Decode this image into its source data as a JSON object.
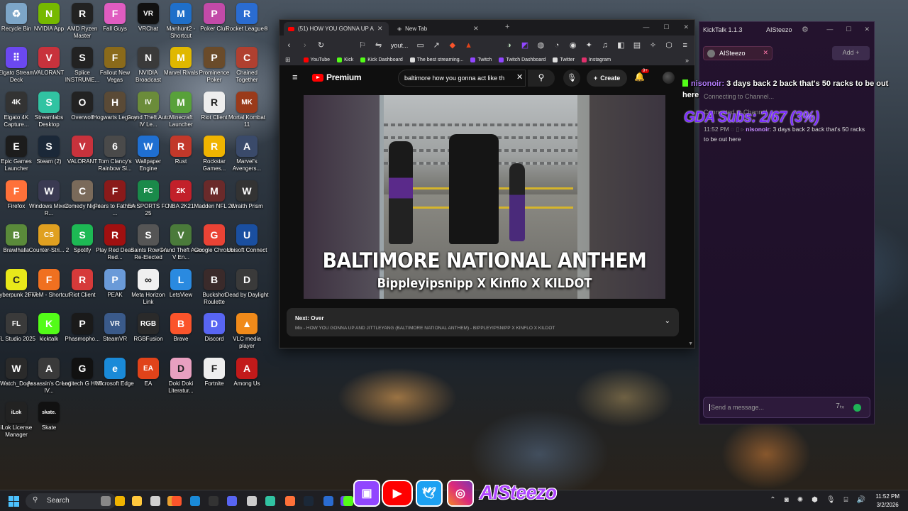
{
  "desktop": {
    "icons": [
      {
        "label": "Recycle Bin",
        "color": "#7da6c8",
        "glyph": "♻"
      },
      {
        "label": "NVIDIA App",
        "color": "#76b900",
        "glyph": "N"
      },
      {
        "label": "AMD Ryzen Master",
        "color": "#222222",
        "glyph": "R"
      },
      {
        "label": "Fall Guys",
        "color": "#e05cc0",
        "glyph": "F"
      },
      {
        "label": "VRChat",
        "color": "#111111",
        "glyph": "VR"
      },
      {
        "label": "Manhunt2 - Shortcut",
        "color": "#1f6fc9",
        "glyph": "M"
      },
      {
        "label": "Poker Club",
        "color": "#c24aa8",
        "glyph": "P"
      },
      {
        "label": "Rocket League®",
        "color": "#2a6cd1",
        "glyph": "R"
      },
      {
        "label": "Elgato Stream Deck",
        "color": "#6b48f0",
        "glyph": "⠿"
      },
      {
        "label": "VALORANT",
        "color": "#c8323c",
        "glyph": "V"
      },
      {
        "label": "Splice INSTRUME...",
        "color": "#222222",
        "glyph": "S"
      },
      {
        "label": "Fallout New Vegas",
        "color": "#8a6a1a",
        "glyph": "F"
      },
      {
        "label": "NVIDIA Broadcast",
        "color": "#3a3a3a",
        "glyph": "N"
      },
      {
        "label": "Marvel Rivals",
        "color": "#e0b800",
        "glyph": "M"
      },
      {
        "label": "Prominence Poker",
        "color": "#6a4b2a",
        "glyph": "P"
      },
      {
        "label": "Chained Together",
        "color": "#b04030",
        "glyph": "C"
      },
      {
        "label": "Elgato 4K Capture...",
        "color": "#333333",
        "glyph": "4K"
      },
      {
        "label": "Streamlabs Desktop",
        "color": "#31c3a2",
        "glyph": "S"
      },
      {
        "label": "Overwolf",
        "color": "#222222",
        "glyph": "O"
      },
      {
        "label": "Hogwarts Legacy",
        "color": "#5a4a36",
        "glyph": "H"
      },
      {
        "label": "Grand Theft Auto IV Le...",
        "color": "#6b8c3a",
        "glyph": "IV"
      },
      {
        "label": "Minecraft Launcher",
        "color": "#58a13a",
        "glyph": "M"
      },
      {
        "label": "Riot Client",
        "color": "#eeeeee",
        "glyph": "R"
      },
      {
        "label": "Mortal Kombat 11",
        "color": "#9a3a1a",
        "glyph": "MK"
      },
      {
        "label": "Epic Games Launcher",
        "color": "#1c1c1c",
        "glyph": "E"
      },
      {
        "label": "Steam (2)",
        "color": "#1b2838",
        "glyph": "S"
      },
      {
        "label": "VALORANT",
        "color": "#c8323c",
        "glyph": "V"
      },
      {
        "label": "Tom Clancy's Rainbow Si...",
        "color": "#4a4a4a",
        "glyph": "6"
      },
      {
        "label": "Wallpaper Engine",
        "color": "#1f6fd1",
        "glyph": "W"
      },
      {
        "label": "Rust",
        "color": "#c2382a",
        "glyph": "R"
      },
      {
        "label": "Rockstar Games...",
        "color": "#f0b400",
        "glyph": "R"
      },
      {
        "label": "Marvel's Avengers...",
        "color": "#3a4a6a",
        "glyph": "A"
      },
      {
        "label": "Firefox",
        "color": "#ff7139",
        "glyph": "F"
      },
      {
        "label": "Windows Mixed R...",
        "color": "#3a3a52",
        "glyph": "W"
      },
      {
        "label": "Comedy Night",
        "color": "#7a6a5a",
        "glyph": "C"
      },
      {
        "label": "Fears to Fathom ...",
        "color": "#8a1a1a",
        "glyph": "F"
      },
      {
        "label": "EA SPORTS FC 25",
        "color": "#1a8a4a",
        "glyph": "FC"
      },
      {
        "label": "NBA 2K21",
        "color": "#c2202a",
        "glyph": "2K"
      },
      {
        "label": "Madden NFL 25",
        "color": "#6a2a2a",
        "glyph": "M"
      },
      {
        "label": "Wraith Prism",
        "color": "#333333",
        "glyph": "W"
      },
      {
        "label": "Brawlhalla",
        "color": "#5a8a3a",
        "glyph": "B"
      },
      {
        "label": "Counter-Stri... 2",
        "color": "#e0a020",
        "glyph": "CS"
      },
      {
        "label": "Spotify",
        "color": "#1db954",
        "glyph": "S"
      },
      {
        "label": "Play Red Dead Red...",
        "color": "#a01010",
        "glyph": "R"
      },
      {
        "label": "Saints Row IV Re-Elected",
        "color": "#555555",
        "glyph": "S"
      },
      {
        "label": "Grand Theft Auto V En...",
        "color": "#4a7a3a",
        "glyph": "V"
      },
      {
        "label": "Google Chrome",
        "color": "#ea4335",
        "glyph": "G"
      },
      {
        "label": "Ubisoft Connect",
        "color": "#1a4fa0",
        "glyph": "U"
      },
      {
        "label": "Cyberpunk 2077",
        "color": "#e8e81a",
        "glyph": "C"
      },
      {
        "label": "FiveM - Shortcut",
        "color": "#f07020",
        "glyph": "F"
      },
      {
        "label": "Riot Client",
        "color": "#d63a3a",
        "glyph": "R"
      },
      {
        "label": "PEAK",
        "color": "#6a9ad8",
        "glyph": "P"
      },
      {
        "label": "Meta Horizon Link",
        "color": "#f0f0f0",
        "glyph": "∞"
      },
      {
        "label": "LetsView",
        "color": "#2a8ae0",
        "glyph": "L"
      },
      {
        "label": "Buckshot Roulette",
        "color": "#3a2a2a",
        "glyph": "B"
      },
      {
        "label": "Dead by Daylight",
        "color": "#3a3a3a",
        "glyph": "D"
      },
      {
        "label": "FL Studio 2025",
        "color": "#3a3a3a",
        "glyph": "FL"
      },
      {
        "label": "kicktalk",
        "color": "#53fc18",
        "glyph": "K"
      },
      {
        "label": "Phasmopho...",
        "color": "#1a1a1a",
        "glyph": "P"
      },
      {
        "label": "SteamVR",
        "color": "#3a5a8a",
        "glyph": "VR"
      },
      {
        "label": "RGBFusion",
        "color": "#2a2a2a",
        "glyph": "RGB"
      },
      {
        "label": "Brave",
        "color": "#fb542b",
        "glyph": "B"
      },
      {
        "label": "Discord",
        "color": "#5865f2",
        "glyph": "D"
      },
      {
        "label": "VLC media player",
        "color": "#f08a1a",
        "glyph": "▲"
      },
      {
        "label": "Watch_Dogs",
        "color": "#2a2a2a",
        "glyph": "W"
      },
      {
        "label": "Assassin's Creed IV...",
        "color": "#3a3a3a",
        "glyph": "A"
      },
      {
        "label": "Logitech G HUB",
        "color": "#111111",
        "glyph": "G"
      },
      {
        "label": "Microsoft Edge",
        "color": "#1a8ad8",
        "glyph": "e"
      },
      {
        "label": "EA",
        "color": "#e0431a",
        "glyph": "EA"
      },
      {
        "label": "Doki Doki Literatur...",
        "color": "#e8a0c0",
        "glyph": "D"
      },
      {
        "label": "Fortnite",
        "color": "#eeeeee",
        "glyph": "F"
      },
      {
        "label": "Among Us",
        "color": "#c21a1a",
        "glyph": "A"
      },
      {
        "label": "iLok License Manager",
        "color": "#222222",
        "glyph": "iLok"
      },
      {
        "label": "Skate",
        "color": "#111111",
        "glyph": "skate."
      }
    ]
  },
  "browser": {
    "tabs": [
      {
        "label": "(51) HOW YOU GONNA UP A",
        "active": true
      },
      {
        "label": "New Tab",
        "active": false
      }
    ],
    "url": "yout...",
    "bookmarks": [
      {
        "label": "YouTube",
        "color": "#ff0000"
      },
      {
        "label": "Kick",
        "color": "#53fc18"
      },
      {
        "label": "Kick Dashboard",
        "color": "#53fc18"
      },
      {
        "label": "The best streaming...",
        "color": "#dddddd"
      },
      {
        "label": "Twitch",
        "color": "#9146ff"
      },
      {
        "label": "Twitch Dashboard",
        "color": "#9146ff"
      },
      {
        "label": "Twitter",
        "color": "#dddddd"
      },
      {
        "label": "Instagram",
        "color": "#e1306c"
      }
    ],
    "youtube": {
      "logo_text": "Premium",
      "search_value": "baltimore how you gonna act like th",
      "create_label": "Create",
      "notification_badge": "9+",
      "video_title_overlay": "BALTIMORE NATIONAL ANTHEM",
      "video_subtitle_overlay": "Bippleyipsnipp X Kinflo X KILDOT",
      "next_label": "Next: Over",
      "next_mix": "Mix - HOW YOU GONNA UP AND JITTLEYANG (BALTIMORE NATIONAL ANTHEM) - BIPPLEYIPSNIPP X KINFLO X KILDOT"
    }
  },
  "kicktalk": {
    "title": "KickTalk 1.1.3",
    "user": "AISteezo",
    "channel_tab": "AISteezo",
    "add_label": "Add",
    "system_messages": [
      "Connecting to Channel...",
      "Connected to Channel"
    ],
    "message": {
      "time": "11:52 PM",
      "user": "nisonoir",
      "text": "3 days back 2 back that's 50 racks to be out here"
    },
    "input_placeholder": "Send a message..."
  },
  "overlay": {
    "chat_user": "nisonoir:",
    "chat_text": "3 days back 2 back that's 50 racks to be out here",
    "goal_text": "GDA Subs: 2/67 (3%)",
    "social_name": "AISteezo"
  },
  "taskbar": {
    "search_label": "Search",
    "time": "11:52 PM",
    "date": "3/2/2026"
  }
}
